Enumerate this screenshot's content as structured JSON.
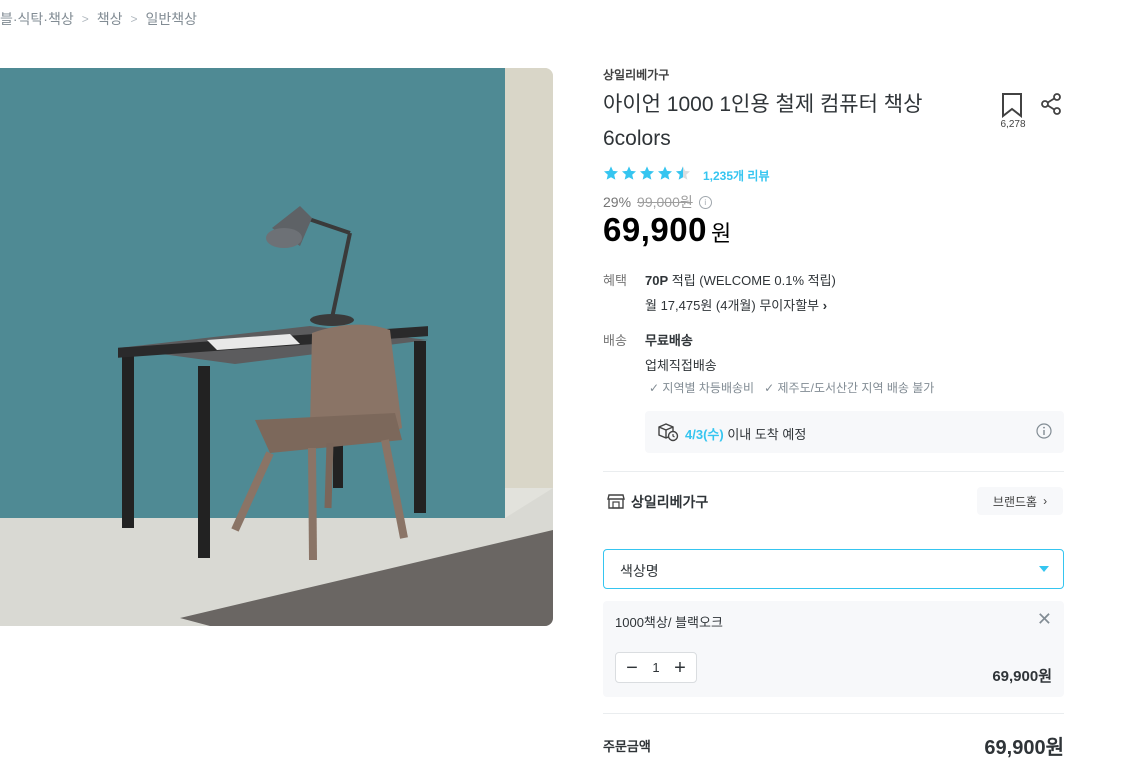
{
  "breadcrumb": [
    "블·식탁·책상",
    "책상",
    "일반책상"
  ],
  "product": {
    "brand": "상일리베가구",
    "title_line1": "아이언 1000 1인용 철제 컴퓨터 책상",
    "title_line2": "6colors",
    "bookmark_count": "6,278",
    "rating": 4.5,
    "review_text": "1,235개 리뷰",
    "discount": "29%",
    "original_price": "99,000원",
    "price": "69,900",
    "price_unit": "원"
  },
  "benefit": {
    "label": "혜택",
    "points_bold": "70P",
    "points_rest": " 적립 (WELCOME 0.1% 적립)",
    "installment": "월 17,475원 (4개월) 무이자할부"
  },
  "delivery": {
    "label": "배송",
    "type": "무료배송",
    "method": "업체직접배송",
    "notes": [
      "지역별 차등배송비",
      "제주도/도서산간 지역 배송 불가"
    ],
    "arrival_date": "4/3(수)",
    "arrival_rest": " 이내 도착 예정"
  },
  "brand_row": {
    "name": "상일리베가구",
    "home_button": "브랜드홈"
  },
  "option_select": {
    "placeholder": "색상명"
  },
  "selected_option": {
    "name": "1000책상/ 블랙오크",
    "quantity": "1",
    "price": "69,900원"
  },
  "order": {
    "label": "주문금액",
    "total": "69,900원"
  },
  "colors": {
    "accent": "#35c5f0",
    "wall": "#4f8a94",
    "floor": "#dcdcd6"
  }
}
